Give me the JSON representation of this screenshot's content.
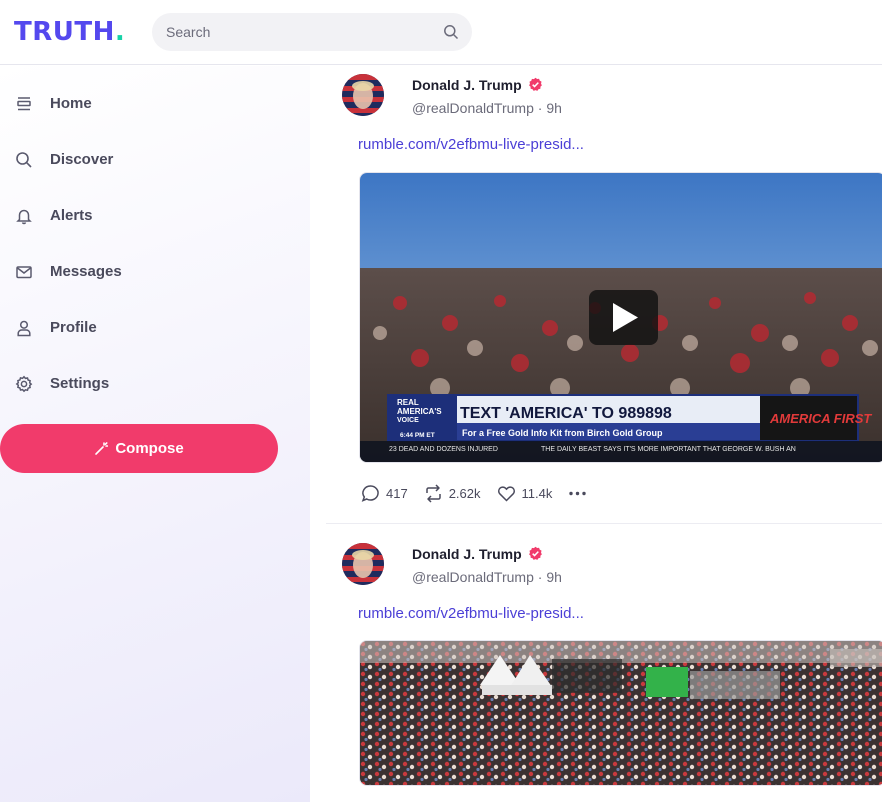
{
  "app": {
    "logo_text": "TRUTH",
    "logo_dot": ".",
    "brand_color": "#5448ee",
    "accent_color": "#17d2a8"
  },
  "search": {
    "placeholder": "Search",
    "icon": "search-icon"
  },
  "sidebar": {
    "items": [
      {
        "label": "Home",
        "icon": "home-icon"
      },
      {
        "label": "Discover",
        "icon": "search-icon"
      },
      {
        "label": "Alerts",
        "icon": "bell-icon"
      },
      {
        "label": "Messages",
        "icon": "mail-icon"
      },
      {
        "label": "Profile",
        "icon": "user-icon"
      },
      {
        "label": "Settings",
        "icon": "gear-icon"
      }
    ],
    "compose_label": "Compose",
    "compose_color": "#f13b6b"
  },
  "feed": {
    "posts": [
      {
        "author": "Donald J. Trump",
        "handle": "@realDonaldTrump",
        "time": "9h",
        "link": "rumble.com/v2efbmu-live-presid...",
        "media": {
          "type": "video",
          "banner_network_1": "REAL",
          "banner_network_2": "AMERICA'S",
          "banner_network_3": "VOICE",
          "banner_time": "6:44 PM ET",
          "banner_headline": "TEXT 'AMERICA' TO 989898",
          "banner_sub": "For a Free Gold Info Kit from Birch Gold Group",
          "banner_logo": "AMERICA FIRST",
          "ticker_left": "23 DEAD AND DOZENS INJURED",
          "ticker_right": "THE DAILY BEAST SAYS IT'S MORE IMPORTANT THAT GEORGE W. BUSH AN"
        },
        "replies": "417",
        "retruths": "2.62k",
        "likes": "11.4k"
      },
      {
        "author": "Donald J. Trump",
        "handle": "@realDonaldTrump",
        "time": "9h",
        "link": "rumble.com/v2efbmu-live-presid...",
        "media": {
          "type": "image"
        }
      }
    ]
  }
}
